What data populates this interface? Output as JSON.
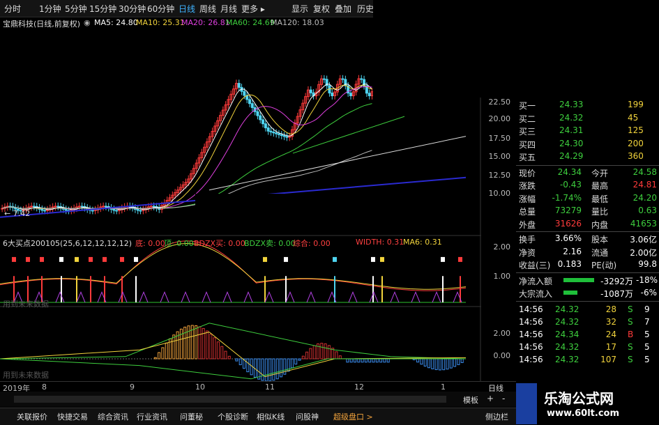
{
  "toolbar": {
    "tabs": [
      "分时",
      "1分钟",
      "5分钟",
      "15分钟",
      "30分钟",
      "60分钟",
      "日线",
      "周线",
      "月线",
      "更多 ▸",
      "显示",
      "复权",
      "叠加",
      "历史"
    ],
    "active": "日线"
  },
  "info": {
    "stock": "宝鼎科技(日线,前复权)",
    "ma5": "MA5: 24.80",
    "ma10": "MA10: 25.31",
    "ma20": "MA20: 26.81",
    "ma60": "MA60: 24.69",
    "ma120": "MA120: 18.03"
  },
  "price_axis": [
    "22.50",
    "20.00",
    "17.50",
    "15.00",
    "12.50",
    "10.00"
  ],
  "low_label": "← 7.42",
  "ind1": {
    "title": "6大买点200105(25,6,12,12,12,12)",
    "di": "底: 0.00",
    "ding": "顶: 0.00",
    "bdzx_up": "BDZX买: 0.00",
    "bdzx_dn": "BDZX卖: 0.00",
    "zonghe": "综合: 0.00",
    "width": "WIDTH: 0.31",
    "ma6": "MA6: 0.31",
    "axis": [
      "2.00",
      "1.00"
    ],
    "watermark": "用到未来数据"
  },
  "ind2": {
    "axis": [
      "2.00",
      "0.00"
    ],
    "watermark": "用到未来数据"
  },
  "date_axis": [
    "2019年",
    "8",
    "9",
    "10",
    "11",
    "12",
    "1"
  ],
  "side": {
    "bids": [
      {
        "label": "买一",
        "price": "24.33",
        "vol": "199"
      },
      {
        "label": "买二",
        "price": "24.32",
        "vol": "45"
      },
      {
        "label": "买三",
        "price": "24.31",
        "vol": "125"
      },
      {
        "label": "买四",
        "price": "24.30",
        "vol": "200"
      },
      {
        "label": "买五",
        "price": "24.29",
        "vol": "360"
      }
    ],
    "stats": [
      {
        "l1": "现价",
        "v1": "24.34",
        "l2": "今开",
        "v2": "24.58"
      },
      {
        "l1": "涨跌",
        "v1": "-0.43",
        "l2": "最高",
        "v2": "24.81"
      },
      {
        "l1": "涨幅",
        "v1": "-1.74%",
        "l2": "最低",
        "v2": "24.20"
      },
      {
        "l1": "总量",
        "v1": "73279",
        "l2": "量比",
        "v2": "0.63"
      },
      {
        "l1": "外盘",
        "v1": "31626",
        "l2": "内盘",
        "v2": "41653"
      },
      {
        "l1": "换手",
        "v1": "3.66%",
        "l2": "股本",
        "v2": "3.06亿"
      },
      {
        "l1": "净资",
        "v1": "2.16",
        "l2": "流通",
        "v2": "2.00亿"
      },
      {
        "l1": "收益(三)",
        "v1": "0.183",
        "l2": "PE(动)",
        "v2": "99.8"
      }
    ],
    "flow": [
      {
        "label": "净流入额",
        "val": "-3292万",
        "pct": "-18%"
      },
      {
        "label": "大宗流入",
        "val": "-1087万",
        "pct": "-6%"
      }
    ],
    "ticks": [
      {
        "time": "14:56",
        "price": "24.32",
        "vol": "28",
        "side": "S",
        "n": "9"
      },
      {
        "time": "14:56",
        "price": "24.32",
        "vol": "32",
        "side": "S",
        "n": "7"
      },
      {
        "time": "14:56",
        "price": "24.34",
        "vol": "24",
        "side": "B",
        "n": "5"
      },
      {
        "time": "14:56",
        "price": "24.32",
        "vol": "17",
        "side": "S",
        "n": "5"
      },
      {
        "time": "14:56",
        "price": "24.32",
        "vol": "107",
        "side": "S",
        "n": "5"
      }
    ]
  },
  "right_label": "日线",
  "zoom_btns": [
    "模板",
    "+",
    "-"
  ],
  "bottom": [
    "关联报价",
    "快捷交易",
    "综合资讯",
    "行业资讯",
    "问董秘",
    "个股诊断",
    "相似K线",
    "问股神",
    "超级盘口 >",
    "侧边栏"
  ],
  "brand": {
    "name": "乐淘公式网",
    "url": "www.60lt.com"
  },
  "chart_data": {
    "type": "line",
    "title": "宝鼎科技(日线,前复权)",
    "x": [
      "2019年",
      "8",
      "9",
      "10",
      "11",
      "12",
      "1"
    ],
    "ylim": [
      7.42,
      25
    ],
    "series": [
      {
        "name": "MA5",
        "values": [
          8.2,
          8.3,
          8.5,
          19.0,
          17.0,
          23.5,
          24.8
        ]
      },
      {
        "name": "MA10",
        "values": [
          8.3,
          8.4,
          8.6,
          18.5,
          17.5,
          23.0,
          25.31
        ]
      },
      {
        "name": "MA20",
        "values": [
          8.4,
          8.5,
          8.7,
          16.0,
          18.0,
          22.0,
          26.81
        ]
      },
      {
        "name": "MA60",
        "values": [
          8.6,
          8.6,
          8.8,
          11.5,
          15.0,
          19.0,
          24.69
        ]
      },
      {
        "name": "MA120",
        "values": [
          8.8,
          8.8,
          8.9,
          9.5,
          11.0,
          14.0,
          18.03
        ]
      }
    ]
  }
}
